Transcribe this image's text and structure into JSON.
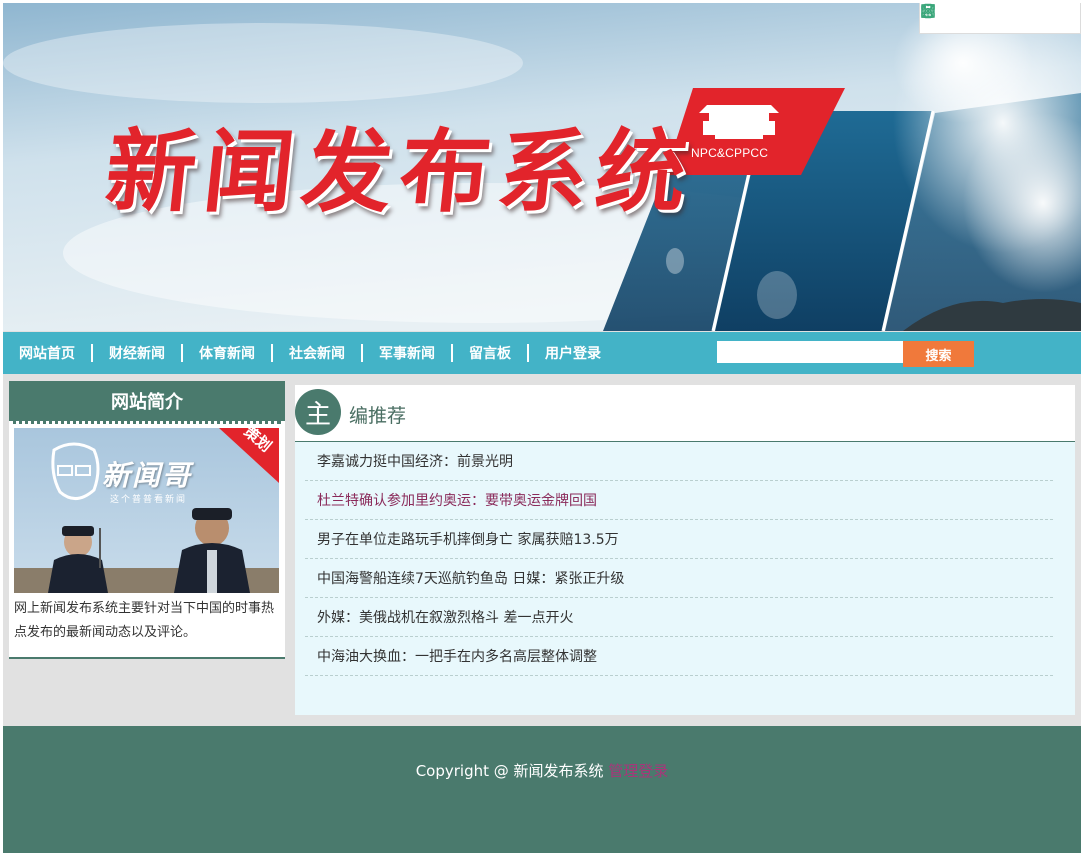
{
  "banner": {
    "title": "新闻发布系统",
    "badge": "NPC&CPPCC"
  },
  "toolbox": {
    "icons": [
      "phone-icon",
      "fullscreen-icon",
      "save-icon",
      "share-icon",
      "settings-icon"
    ]
  },
  "nav": {
    "items": [
      "网站首页",
      "财经新闻",
      "体育新闻",
      "社会新闻",
      "军事新闻",
      "留言板",
      "用户登录"
    ],
    "search_placeholder": "",
    "search_button": "搜索"
  },
  "sidebar": {
    "title": "网站简介",
    "photo_logo": "新闻哥",
    "photo_sub": "这个普普看新闻",
    "photo_ribbon": "策划",
    "description": "网上新闻发布系统主要针对当下中国的时事热点发布的最新闻动态以及评论。"
  },
  "main": {
    "head_circle": "主",
    "head_text": "编推荐",
    "news": [
      {
        "title": "李嘉诚力挺中国经济：前景光明",
        "visited": false
      },
      {
        "title": "杜兰特确认参加里约奥运：要带奥运金牌回国",
        "visited": true
      },
      {
        "title": "男子在单位走路玩手机摔倒身亡 家属获赔13.5万",
        "visited": false
      },
      {
        "title": "中国海警船连续7天巡航钓鱼岛 日媒：紧张正升级",
        "visited": false
      },
      {
        "title": "外媒：美俄战机在叙激烈格斗 差一点开火",
        "visited": false
      },
      {
        "title": "中海油大换血：一把手在内多名高层整体调整",
        "visited": false
      }
    ]
  },
  "footer": {
    "copyright": "Copyright @ 新闻发布系统 ",
    "admin_link": "管理登录"
  },
  "colors": {
    "nav_bg": "#43b3c7",
    "theme_green": "#4a7a6d",
    "search_button": "#f0793b",
    "title_red": "#e2242b",
    "visited_link": "#8a2a5a",
    "news_bg": "#e8f8fc"
  }
}
